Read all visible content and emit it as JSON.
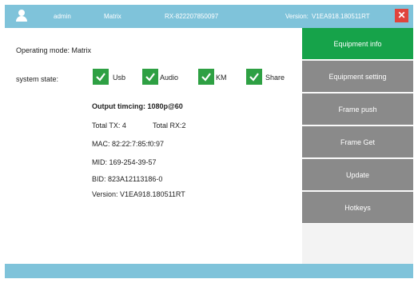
{
  "titlebar": {
    "user": "admin",
    "mode": "Matrix",
    "device_id": "RX-822207850097",
    "version_label": "Version:",
    "version": "V1EA918.180511RT",
    "close": "✕"
  },
  "main": {
    "operating_mode": "Operating mode: Matrix",
    "system_state_label": "system state:",
    "states": [
      {
        "label": "Usb",
        "checked": true
      },
      {
        "label": "Audio",
        "checked": true
      },
      {
        "label": "KM",
        "checked": true
      },
      {
        "label": "Share",
        "checked": true
      }
    ],
    "output_timing": "Output timcing: 1080p@60",
    "total_tx": "Total TX: 4",
    "total_rx": "Total RX:2",
    "mac": "MAC: 82:22:7:85:f0:97",
    "mid": "MID:  169-254-39-57",
    "bid": "BID: 823A12113186-0",
    "version": "Version: V1EA918.180511RT"
  },
  "sidebar": {
    "items": [
      {
        "label": "Equipment info",
        "active": true
      },
      {
        "label": "Equipment setting",
        "active": false
      },
      {
        "label": "Frame push",
        "active": false
      },
      {
        "label": "Frame Get",
        "active": false
      },
      {
        "label": "Update",
        "active": false
      },
      {
        "label": "Hotkeys",
        "active": false
      }
    ]
  },
  "colors": {
    "titlebar": "#7fc3da",
    "nav_active": "#16a34a",
    "nav_inactive": "#8a8a8a",
    "check": "#2ea043",
    "close": "#e0443c"
  }
}
